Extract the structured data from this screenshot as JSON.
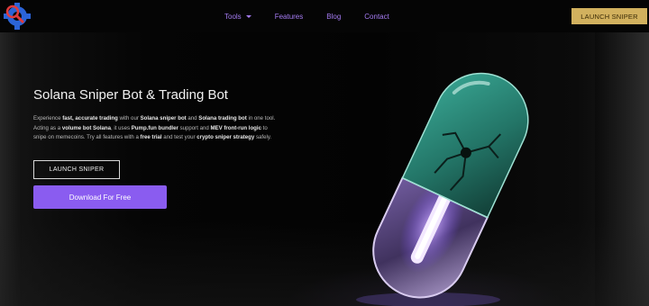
{
  "nav": {
    "items": [
      {
        "label": "Tools",
        "has_dropdown": true
      },
      {
        "label": "Features"
      },
      {
        "label": "Blog"
      },
      {
        "label": "Contact"
      }
    ],
    "cta_label": "LAUNCH SNIPER",
    "colors": {
      "link": "#a57bf2",
      "cta_bg": "#d2b15e"
    }
  },
  "hero": {
    "title": "Solana Sniper Bot & Trading Bot",
    "desc": {
      "l1a": "Experience ",
      "l1b": "fast, accurate trading",
      "l1c": " with our ",
      "l1d": "Solana sniper bot",
      "l1e": " and ",
      "l1f": "Solana trading bot",
      "l1g": " in one tool.",
      "l2a": "Acting as a ",
      "l2b": "volume bot Solana",
      "l2c": ", it uses ",
      "l2d": "Pump.fun bundler",
      "l2e": " support and ",
      "l2f": "MEV front-run logic",
      "l2g": " to",
      "l3a": "snipe on memecoins. Try all features with a ",
      "l3b": "free trial",
      "l3c": " and test your ",
      "l3d": "crypto sniper strategy",
      "l3e": " safely."
    },
    "btn_outline_label": "LAUNCH SNIPER",
    "btn_primary_label": "Download For Free",
    "colors": {
      "primary": "#8a5cf0",
      "capsule_top": "#2e8a7a",
      "capsule_glow": "#c9a6ff"
    }
  },
  "icons": {
    "logo": "bot-gear-logo-icon",
    "caret": "chevron-down-icon",
    "pill": "cracked-capsule-pill-icon"
  }
}
